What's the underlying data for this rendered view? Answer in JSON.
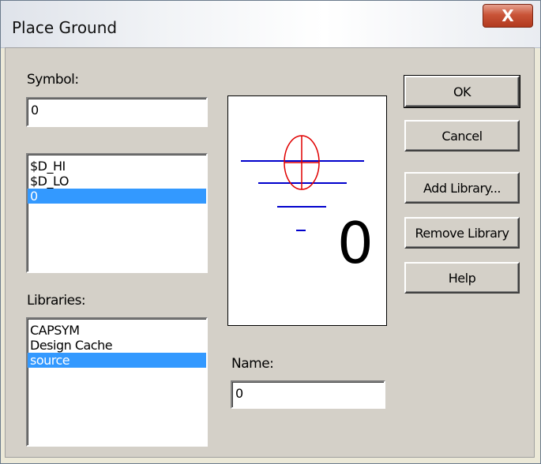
{
  "window": {
    "title": "Place Ground",
    "close_glyph": "X"
  },
  "symbol": {
    "label": "Symbol:",
    "value": "0"
  },
  "symbol_list": {
    "items": [
      "$D_HI",
      "$D_LO",
      "0"
    ],
    "selected_index": 2
  },
  "libraries": {
    "label": "Libraries:",
    "items": [
      "CAPSYM",
      "Design Cache",
      "source"
    ],
    "selected_index": 2
  },
  "preview": {
    "symbol_text": "0"
  },
  "name": {
    "label": "Name:",
    "value": "0"
  },
  "buttons": {
    "ok": "OK",
    "cancel": "Cancel",
    "add_library": "Add Library...",
    "remove_library": "Remove Library",
    "help": "Help"
  },
  "colors": {
    "selection": "#3399ff",
    "ground_lines": "#0000cc",
    "marker": "#e00000",
    "dialog_face": "#d4d0c8"
  }
}
